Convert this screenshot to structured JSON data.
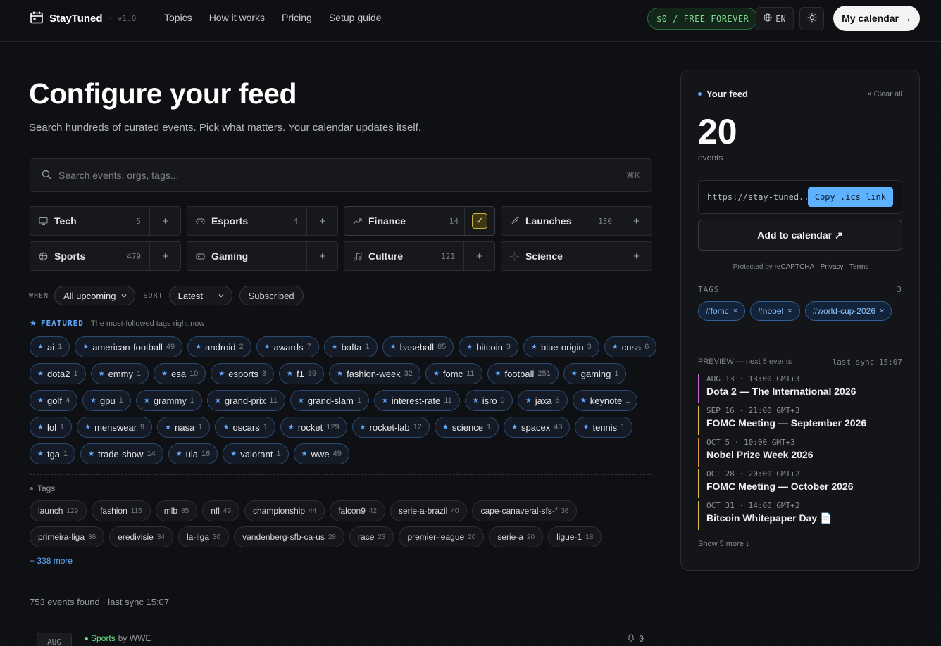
{
  "header": {
    "brand": "StayTuned",
    "version": "· v1.0",
    "nav": [
      "Topics",
      "How it works",
      "Pricing",
      "Setup guide"
    ],
    "free_badge": "$0 / FREE FOREVER",
    "lang": "EN",
    "cta": "My calendar →"
  },
  "main": {
    "title": "Configure your feed",
    "subtitle": "Search hundreds of curated events. Pick what matters. Your calendar updates itself.",
    "search_placeholder": "Search events, orgs, tags...",
    "search_kbd": "⌘K",
    "categories": [
      {
        "label": "Tech",
        "count": "5",
        "icon": "monitor-icon",
        "state": "add"
      },
      {
        "label": "Esports",
        "count": "4",
        "icon": "gamepad-icon",
        "state": "add"
      },
      {
        "label": "Finance",
        "count": "14",
        "icon": "trend-icon",
        "state": "checked"
      },
      {
        "label": "Launches",
        "count": "130",
        "icon": "rocket-icon",
        "state": "add"
      },
      {
        "label": "Sports",
        "count": "479",
        "icon": "globe-icon",
        "state": "add"
      },
      {
        "label": "Gaming",
        "count": "",
        "icon": "console-icon",
        "state": "add"
      },
      {
        "label": "Culture",
        "count": "121",
        "icon": "music-icon",
        "state": "add"
      },
      {
        "label": "Science",
        "count": "",
        "icon": "sun-icon",
        "state": "add"
      }
    ],
    "filters": {
      "when_label": "WHEN",
      "when_value": "All upcoming",
      "sort_label": "SORT",
      "sort_value": "Latest",
      "subscribed": "Subscribed"
    },
    "featured": {
      "title": "FEATURED",
      "desc": "The most-followed tags right now",
      "tags": [
        {
          "name": "ai",
          "n": "1"
        },
        {
          "name": "american-football",
          "n": "49"
        },
        {
          "name": "android",
          "n": "2"
        },
        {
          "name": "awards",
          "n": "7"
        },
        {
          "name": "bafta",
          "n": "1"
        },
        {
          "name": "baseball",
          "n": "85"
        },
        {
          "name": "bitcoin",
          "n": "3"
        },
        {
          "name": "blue-origin",
          "n": "3"
        },
        {
          "name": "cnsa",
          "n": "6"
        },
        {
          "name": "dota2",
          "n": "1"
        },
        {
          "name": "emmy",
          "n": "1"
        },
        {
          "name": "esa",
          "n": "10"
        },
        {
          "name": "esports",
          "n": "3"
        },
        {
          "name": "f1",
          "n": "39"
        },
        {
          "name": "fashion-week",
          "n": "32"
        },
        {
          "name": "fomc",
          "n": "11"
        },
        {
          "name": "football",
          "n": "251"
        },
        {
          "name": "gaming",
          "n": "1"
        },
        {
          "name": "golf",
          "n": "4"
        },
        {
          "name": "gpu",
          "n": "1"
        },
        {
          "name": "grammy",
          "n": "1"
        },
        {
          "name": "grand-prix",
          "n": "11"
        },
        {
          "name": "grand-slam",
          "n": "1"
        },
        {
          "name": "interest-rate",
          "n": "11"
        },
        {
          "name": "isro",
          "n": "9"
        },
        {
          "name": "jaxa",
          "n": "6"
        },
        {
          "name": "keynote",
          "n": "1"
        },
        {
          "name": "lol",
          "n": "1"
        },
        {
          "name": "menswear",
          "n": "9"
        },
        {
          "name": "nasa",
          "n": "1"
        },
        {
          "name": "oscars",
          "n": "1"
        },
        {
          "name": "rocket",
          "n": "129"
        },
        {
          "name": "rocket-lab",
          "n": "12"
        },
        {
          "name": "science",
          "n": "1"
        },
        {
          "name": "spacex",
          "n": "43"
        },
        {
          "name": "tennis",
          "n": "1"
        },
        {
          "name": "tga",
          "n": "1"
        },
        {
          "name": "trade-show",
          "n": "14"
        },
        {
          "name": "ula",
          "n": "16"
        },
        {
          "name": "valorant",
          "n": "1"
        },
        {
          "name": "wwe",
          "n": "49"
        }
      ]
    },
    "tags_title": "Tags",
    "tags": [
      {
        "name": "launch",
        "n": "129"
      },
      {
        "name": "fashion",
        "n": "115"
      },
      {
        "name": "mlb",
        "n": "85"
      },
      {
        "name": "nfl",
        "n": "49"
      },
      {
        "name": "championship",
        "n": "44"
      },
      {
        "name": "falcon9",
        "n": "42"
      },
      {
        "name": "serie-a-brazil",
        "n": "40"
      },
      {
        "name": "cape-canaveral-sfs-f",
        "n": "36"
      },
      {
        "name": "primeira-liga",
        "n": "36"
      },
      {
        "name": "eredivisie",
        "n": "34"
      },
      {
        "name": "la-liga",
        "n": "30"
      },
      {
        "name": "vandenberg-sfb-ca-us",
        "n": "28"
      },
      {
        "name": "race",
        "n": "23"
      },
      {
        "name": "premier-league",
        "n": "20"
      },
      {
        "name": "serie-a",
        "n": "20"
      },
      {
        "name": "ligue-1",
        "n": "18"
      }
    ],
    "more": "+ 338 more",
    "found": "753 events found · last sync 15:07",
    "event": {
      "date": "AUG",
      "category": "Sports",
      "by": "by WWE",
      "bell": "0"
    }
  },
  "panel": {
    "title": "Your feed",
    "clear": "× Clear all",
    "count": "20",
    "count_label": "events",
    "url": "https://stay-tuned...",
    "copy": "Copy .ics link",
    "add": "Add to calendar ↗",
    "protected_pre": "Protected by",
    "recaptcha": "reCAPTCHA",
    "privacy": "Privacy",
    "terms": "Terms",
    "tags_label": "TAGS",
    "tags_count": "3",
    "tags": [
      "#fomc",
      "#nobel",
      "#world-cup-2026"
    ],
    "preview_label": "PREVIEW — next 5 events",
    "last_sync": "last sync 15:07",
    "preview": [
      {
        "time": "AUG 13 · 13:00 GMT+3",
        "name": "Dota 2 — The International 2026",
        "color": "#c86bd8"
      },
      {
        "time": "SEP 16 · 21:00 GMT+3",
        "name": "FOMC Meeting — September 2026",
        "color": "#d9c24a"
      },
      {
        "time": "OCT 5 · 10:00 GMT+3",
        "name": "Nobel Prize Week 2026",
        "color": "#e0944a"
      },
      {
        "time": "OCT 28 · 20:00 GMT+2",
        "name": "FOMC Meeting — October 2026",
        "color": "#d9c24a"
      },
      {
        "time": "OCT 31 · 14:00 GMT+2",
        "name": "Bitcoin Whitepaper Day 📄",
        "color": "#d9c24a"
      }
    ],
    "show_more": "Show 5 more ↓"
  }
}
